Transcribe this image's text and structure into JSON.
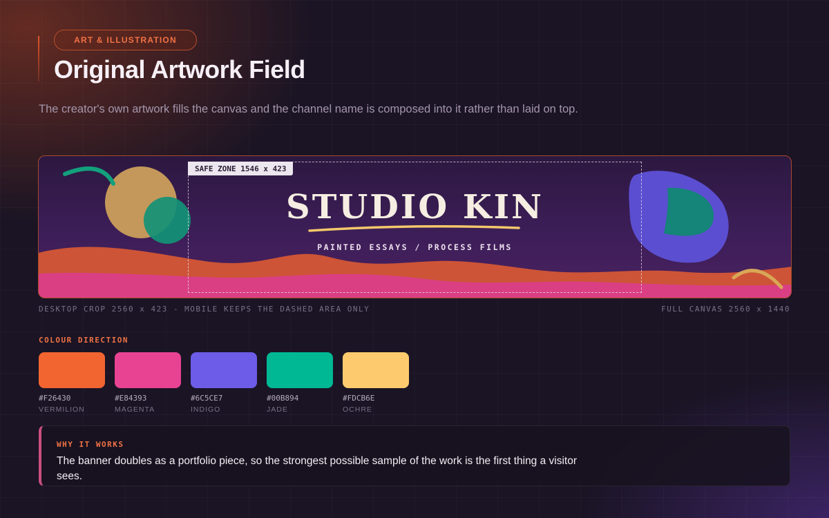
{
  "header": {
    "tag": "ART & ILLUSTRATION",
    "title": "Original Artwork Field",
    "subtitle": "The creator's own artwork fills the canvas and the channel name is composed into it rather than laid on top."
  },
  "banner": {
    "safe_zone_label": "SAFE ZONE 1546 x 423",
    "channel_name": "STUDIO KIN",
    "tagline": "PAINTED ESSAYS / PROCESS FILMS",
    "caption_left": "DESKTOP CROP 2560 x 423 - MOBILE KEEPS THE DASHED AREA ONLY",
    "caption_right": "FULL CANVAS 2560 x 1440"
  },
  "palette": {
    "label": "COLOUR DIRECTION",
    "swatches": [
      {
        "hex": "#F26430",
        "name": "VERMILION"
      },
      {
        "hex": "#E84393",
        "name": "MAGENTA"
      },
      {
        "hex": "#6C5CE7",
        "name": "INDIGO"
      },
      {
        "hex": "#00B894",
        "name": "JADE"
      },
      {
        "hex": "#FDCB6E",
        "name": "OCHRE"
      }
    ]
  },
  "callout": {
    "label": "WHY IT WORKS",
    "body": "The banner doubles as a portfolio piece, so the strongest possible sample of the work is the first thing a visitor sees."
  }
}
